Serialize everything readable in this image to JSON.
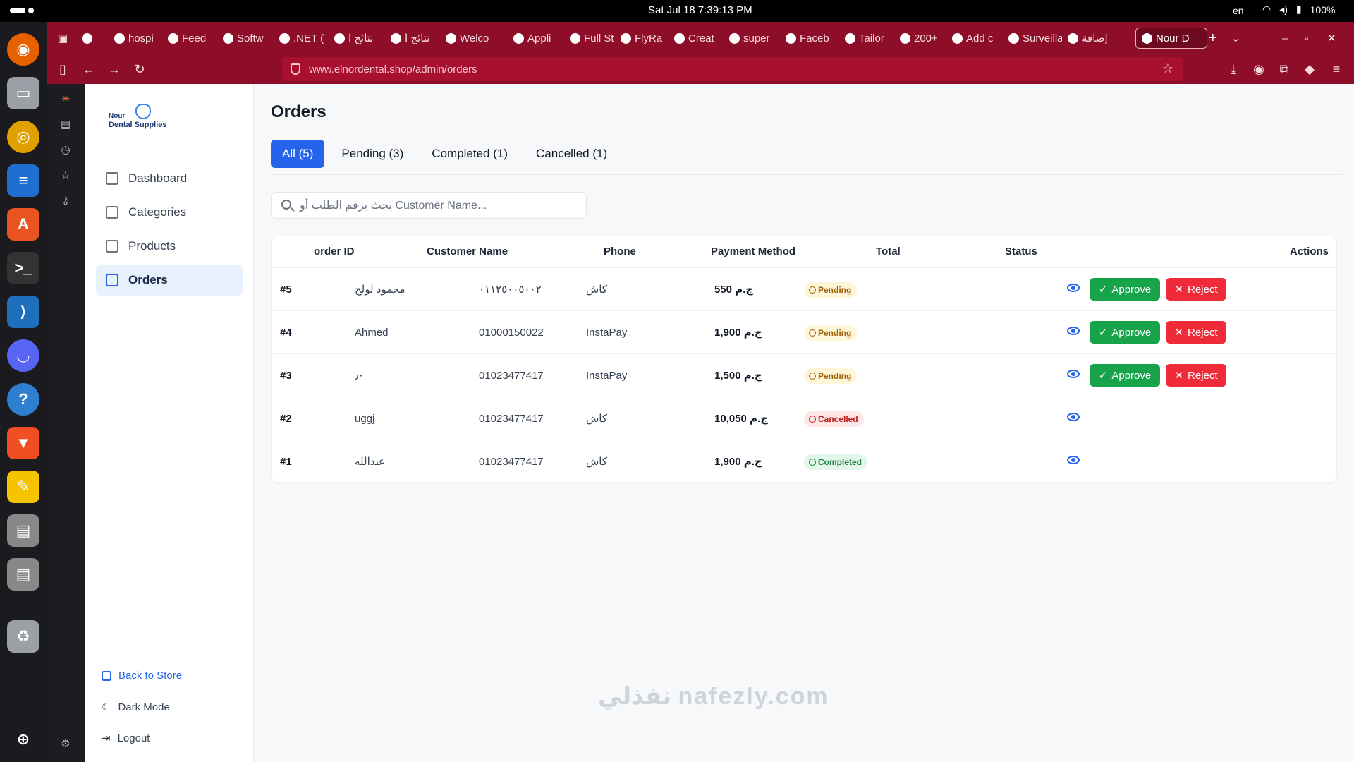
{
  "system": {
    "clock": "Sat Jul 18   7:39:13 PM",
    "lang": "en",
    "battery": "100%"
  },
  "browser": {
    "tabs": [
      {
        "label": "18",
        "icon": "counter-icon"
      },
      {
        "label": "hospi",
        "icon": "site-icon"
      },
      {
        "label": "Feed",
        "icon": "linkedin-icon"
      },
      {
        "label": "Softw",
        "icon": "site-icon"
      },
      {
        "label": ".NET (",
        "icon": "site-icon"
      },
      {
        "label": "نتائج ا",
        "icon": "gmail-icon"
      },
      {
        "label": "نتائج ا",
        "icon": "gmail-icon"
      },
      {
        "label": "Welco",
        "icon": "gmail-icon"
      },
      {
        "label": "Appli",
        "icon": "site-icon"
      },
      {
        "label": "Full St",
        "icon": "site-icon"
      },
      {
        "label": "FlyRa",
        "icon": "site-icon"
      },
      {
        "label": "Creat",
        "icon": "site-icon"
      },
      {
        "label": "super",
        "icon": "github-icon"
      },
      {
        "label": "Faceb",
        "icon": "facebook-icon"
      },
      {
        "label": "Tailor",
        "icon": "site-icon"
      },
      {
        "label": "200+",
        "icon": "info-icon"
      },
      {
        "label": "Add c",
        "icon": "info-icon"
      },
      {
        "label": "Surveilla",
        "icon": "site-icon"
      },
      {
        "label": "إضافة",
        "icon": "site-icon"
      },
      {
        "label": "Nour D",
        "icon": "site-icon",
        "active": true
      }
    ],
    "url": "www.elnordental.shop/admin/orders"
  },
  "sidebar": {
    "logo_line1": "Nour",
    "logo_line2": "Dental Supplies",
    "items": [
      {
        "label": "Dashboard"
      },
      {
        "label": "Categories"
      },
      {
        "label": "Products"
      },
      {
        "label": "Orders",
        "active": true
      }
    ],
    "back_to_store": "Back to Store",
    "dark_mode": "Dark Mode",
    "logout": "Logout"
  },
  "main": {
    "title": "Orders",
    "filters": [
      "All (5)",
      "Pending (3)",
      "Completed (1)",
      "Cancelled (1)"
    ],
    "search_placeholder": "بحث برقم الطلب أو Customer Name...",
    "columns": [
      "order ID",
      "Customer Name",
      "Phone",
      "Payment Method",
      "Total",
      "Status",
      "Actions"
    ],
    "actions": {
      "approve": "Approve",
      "reject": "Reject"
    },
    "orders": [
      {
        "id": "#5",
        "customer": "محمود لولح",
        "phone": "٠١١٢٥٠٠٥٠٠٢",
        "payment": "كاش",
        "total": "550 ج.م",
        "status": "Pending"
      },
      {
        "id": "#4",
        "customer": "Ahmed",
        "phone": "01000150022",
        "payment": "InstaPay",
        "total": "1,900 ج.م",
        "status": "Pending"
      },
      {
        "id": "#3",
        "customer": "٫٠",
        "phone": "01023477417",
        "payment": "InstaPay",
        "total": "1,500 ج.م",
        "status": "Pending"
      },
      {
        "id": "#2",
        "customer": "uggj",
        "phone": "01023477417",
        "payment": "كاش",
        "total": "10,050 ج.م",
        "status": "Cancelled"
      },
      {
        "id": "#1",
        "customer": "عبدالله",
        "phone": "01023477417",
        "payment": "كاش",
        "total": "1,900 ج.م",
        "status": "Completed"
      }
    ]
  },
  "watermark": "نفذلي nafezly.com",
  "colors": {
    "accent": "#2563eb",
    "approve": "#16a34a",
    "reject": "#ef2b3a",
    "browser": "#8e0d28"
  }
}
